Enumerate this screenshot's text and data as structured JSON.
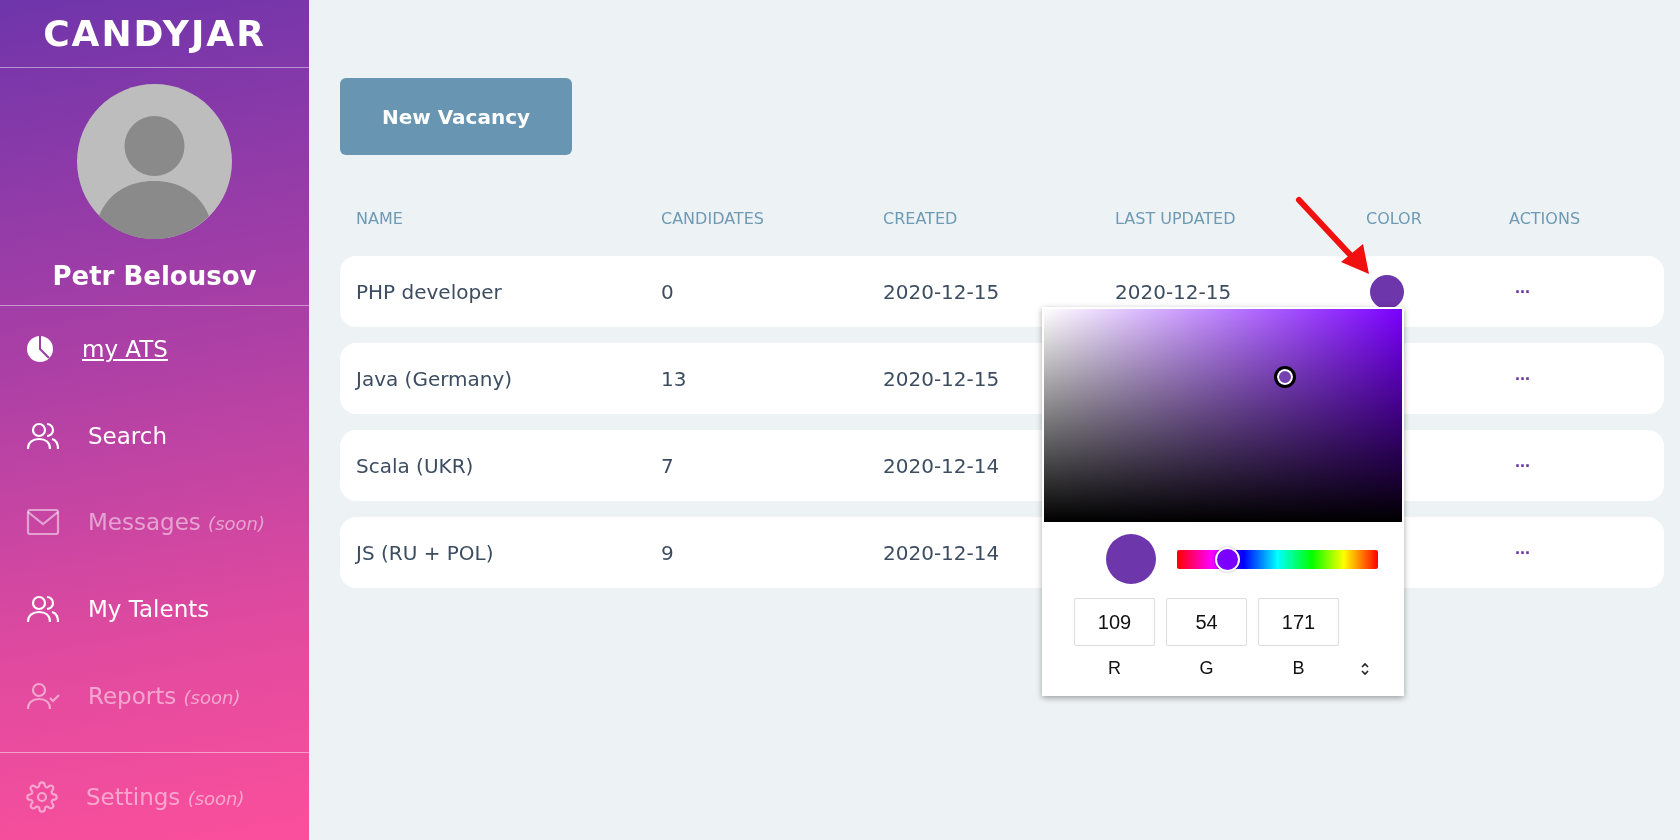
{
  "sidebar": {
    "logo": "CANDYJAR",
    "user_name": "Petr Belousov",
    "items": [
      {
        "label": "my ATS",
        "selected": true,
        "disabled": false
      },
      {
        "label": "Search",
        "selected": false,
        "disabled": false
      },
      {
        "label": "Messages",
        "note": "(soon)",
        "selected": false,
        "disabled": true
      },
      {
        "label": "My Talents",
        "selected": false,
        "disabled": false
      },
      {
        "label": "Reports",
        "note": "(soon)",
        "selected": false,
        "disabled": true
      }
    ],
    "footer_items": [
      {
        "label": "Settings",
        "note": "(soon)",
        "selected": false,
        "disabled": true
      }
    ]
  },
  "new_vacancy_button": "New Vacancy",
  "table": {
    "columns": [
      "NAME",
      "CANDIDATES",
      "CREATED",
      "LAST UPDATED",
      "COLOR",
      "ACTIONS"
    ],
    "rows": [
      {
        "name": "PHP developer",
        "candidates": "0",
        "created": "2020-12-15",
        "last_updated": "2020-12-15",
        "color": "#6d36ab",
        "actions": "..."
      },
      {
        "name": "Java (Germany)",
        "candidates": "13",
        "created": "2020-12-15",
        "actions": "..."
      },
      {
        "name": "Scala (UKR)",
        "candidates": "7",
        "created": "2020-12-14",
        "actions": "..."
      },
      {
        "name": "JS (RU + POL)",
        "candidates": "9",
        "created": "2020-12-14",
        "actions": "..."
      }
    ]
  },
  "color_picker": {
    "hue_slider": {
      "level": 0.25
    },
    "fields": [
      {
        "label": "R",
        "value": "109"
      },
      {
        "label": "G",
        "value": "54"
      },
      {
        "label": "B",
        "value": "171"
      }
    ]
  }
}
